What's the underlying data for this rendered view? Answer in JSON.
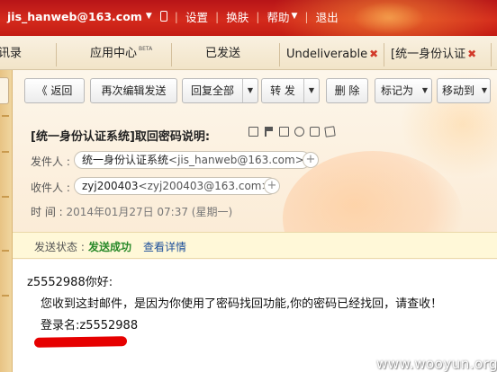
{
  "topbar": {
    "user": "jis_hanweb@163.com",
    "caret": "▼",
    "links": [
      "设置",
      "换肤",
      "帮助",
      "退出"
    ],
    "help_caret": "▼"
  },
  "tabs": [
    {
      "label": "讯录"
    },
    {
      "label": "应用中心",
      "badge": "BETA"
    },
    {
      "label": "已发送"
    },
    {
      "label": "Undeliverable",
      "closable": true
    },
    {
      "label": "[统一身份认证",
      "closable": true
    }
  ],
  "tab_close_glyph": "✖",
  "toolbar": {
    "back": "《 返回",
    "reedit": "再次编辑发送",
    "reply_all": "回复全部",
    "forward": "转 发",
    "delete": "删 除",
    "mark_as": "标记为",
    "move_to": "移动到",
    "dropdown": "▼"
  },
  "message": {
    "subject": "[统一身份认证系统]取回密码说明:",
    "subject_icons": [
      "mail-icon",
      "flag-icon",
      "folder-icon",
      "reply-icon",
      "print-icon",
      "note-icon"
    ],
    "from_label": "发件人 :",
    "from_name": "统一身份认证系统",
    "from_addr": "<jis_hanweb@163.com>",
    "to_label": "收件人 :",
    "to_name": "zyj200403",
    "to_addr": "<zyj200403@163.com>",
    "plus": "+",
    "time_label": "时  间 :",
    "time_value": "2014年01月27日 07:37 (星期一)"
  },
  "status": {
    "label": "发送状态 :",
    "value": "发送成功",
    "detail": "查看详情"
  },
  "body": {
    "greeting": "z5552988你好:",
    "line1": "您收到这封邮件，是因为你使用了密码找回功能,你的密码已经找回，请查收！",
    "login": "登录名:z5552988"
  },
  "watermark": "www.wooyun.org",
  "colors": {
    "topbar": "#c41c14",
    "status_success": "#2a8a2a",
    "link": "#1d4f9a",
    "redaction": "#e60000"
  }
}
